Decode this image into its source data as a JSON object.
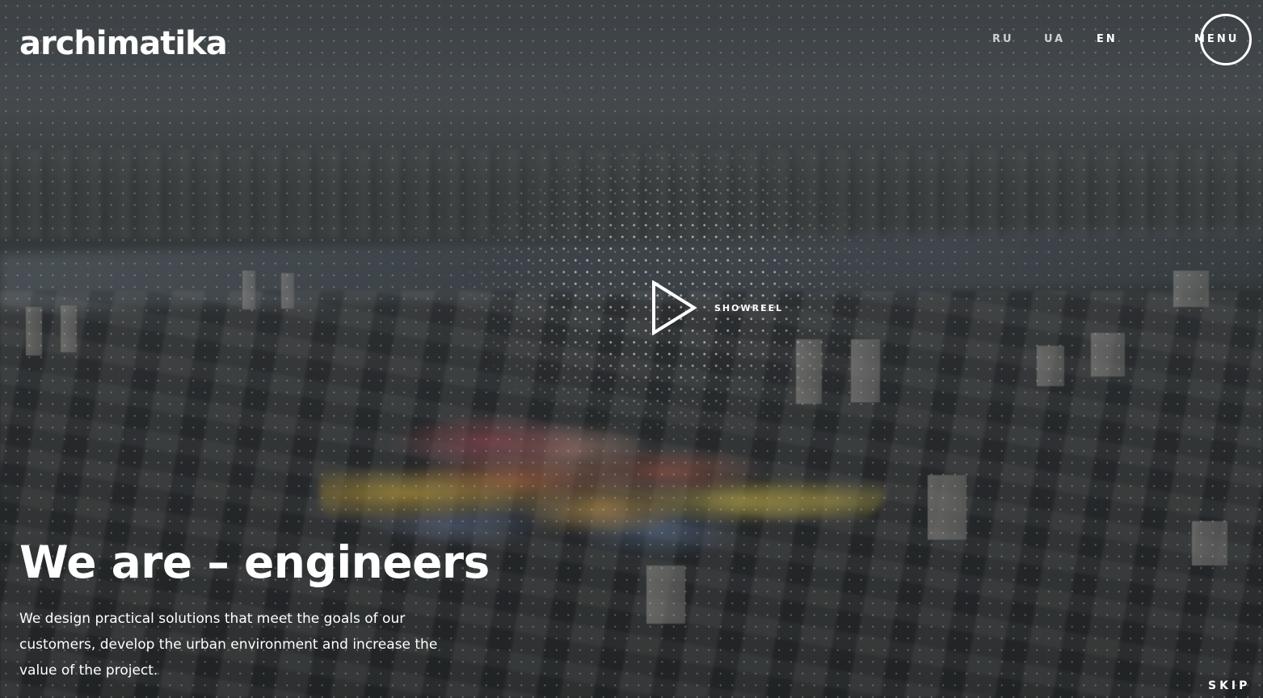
{
  "brand": {
    "logo_text": "archimatika"
  },
  "header": {
    "languages": [
      {
        "label": "RU",
        "active": false
      },
      {
        "label": "UA",
        "active": false
      },
      {
        "label": "EN",
        "active": true
      }
    ],
    "menu_label": "MENU"
  },
  "hero": {
    "showreel_label": "SHOWREEL",
    "headline": "We are – engineers",
    "description": "We design practical solutions that meet the goals of our customers, develop the urban environment and increase the value of the project.",
    "skip_label": "SKIP"
  },
  "icons": {
    "showreel": "play-icon"
  },
  "colors": {
    "text": "#ffffff",
    "overlay": "#2a2c2e"
  }
}
